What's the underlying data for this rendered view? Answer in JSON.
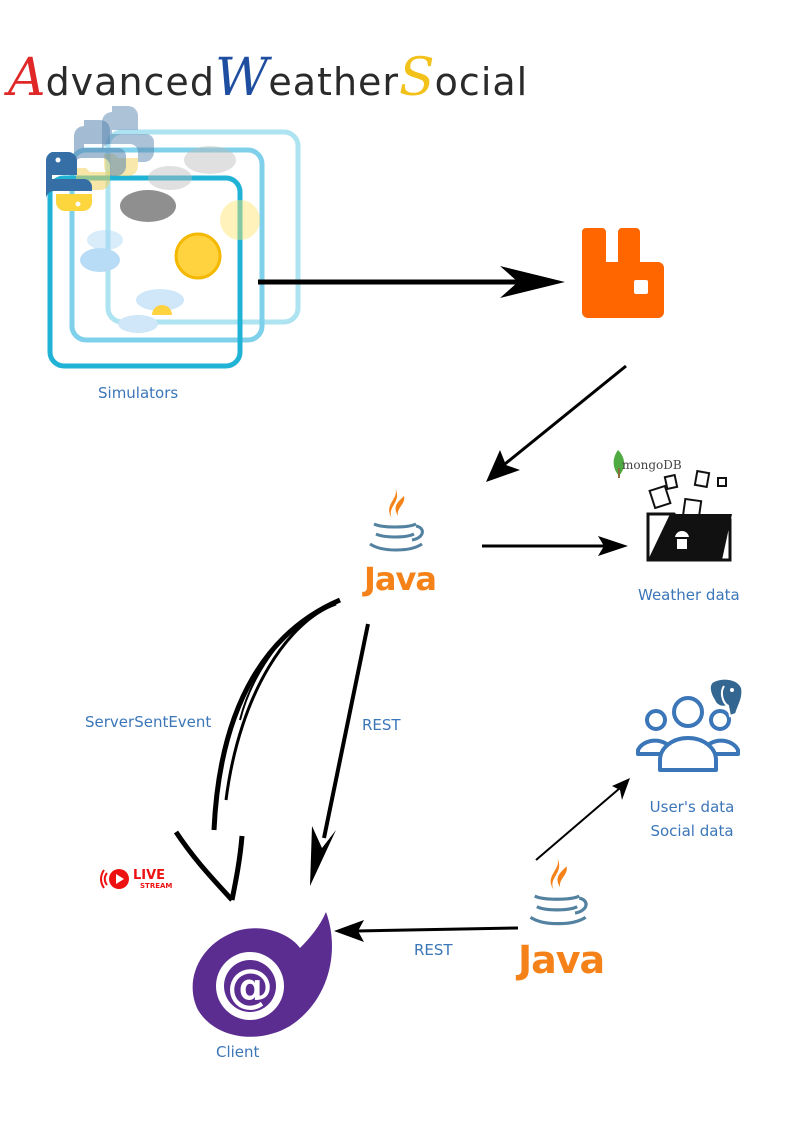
{
  "title": {
    "part1_initial": "A",
    "part1_rest": "dvanced",
    "part2_initial": "W",
    "part2_rest": "eather",
    "part3_initial": "S",
    "part3_rest": "ocial",
    "colors": {
      "A": "#e02828",
      "W": "#1f4ea1",
      "S": "#f2c21b"
    }
  },
  "nodes": {
    "simulators": {
      "label": "Simulators",
      "icon": "python-icon"
    },
    "broker": {
      "icon": "rabbitmq-icon",
      "color": "#ff6600"
    },
    "java_service_1": {
      "word": "Java",
      "icon": "java-icon"
    },
    "weather_db": {
      "label": "Weather data",
      "icon": "mongodb-icon",
      "brand": "mongoDB"
    },
    "social_db": {
      "label_line1": "User's data",
      "label_line2": "Social data",
      "icon": "postgresql-icon"
    },
    "java_service_2": {
      "word": "Java",
      "icon": "java-icon"
    },
    "client": {
      "label": "Client",
      "icon": "blazor-icon",
      "color": "#5c2d91"
    },
    "live_badge": {
      "line1": "LIVE",
      "line2": "STREAM"
    }
  },
  "edges": {
    "sse": "ServerSentEvent",
    "rest_1": "REST",
    "rest_2": "REST"
  }
}
